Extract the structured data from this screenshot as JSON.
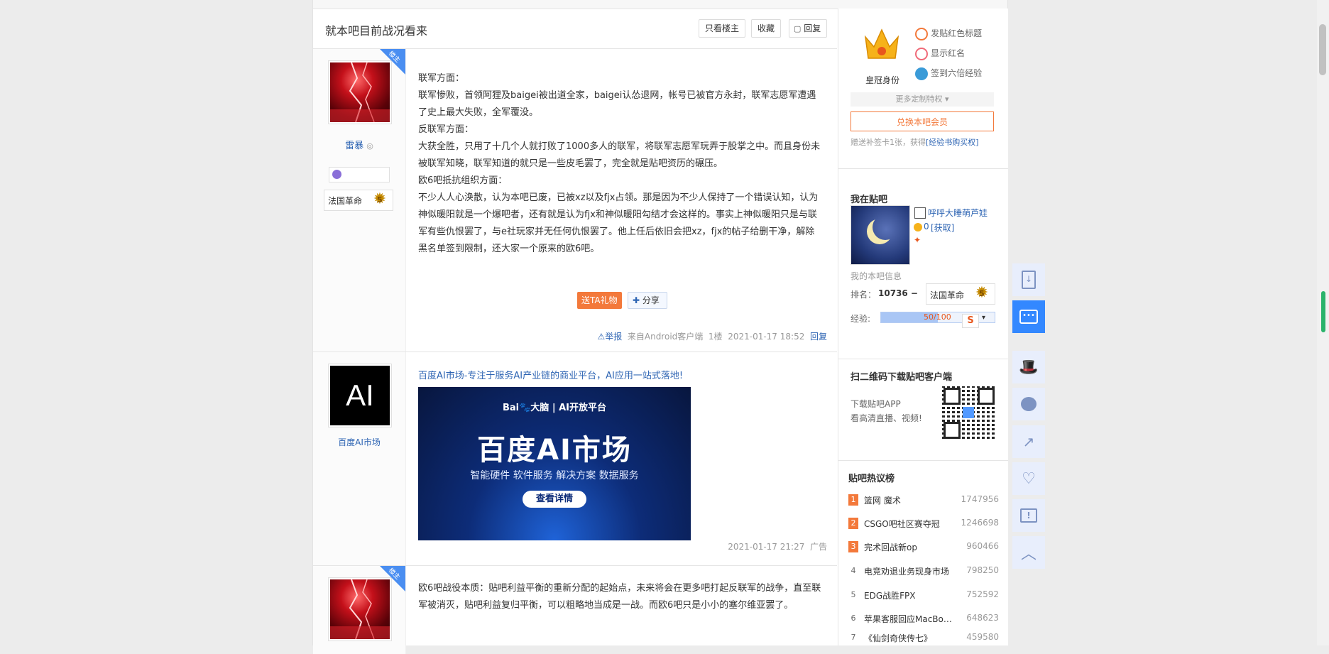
{
  "thread": {
    "title": "就本吧目前战况看来",
    "buttons": {
      "only_op": "只看楼主",
      "favorite": "收藏",
      "reply": "回复"
    }
  },
  "post1": {
    "badge": "楼主",
    "author": "雷暴",
    "tag": "法国革命",
    "level": "5",
    "paragraphs": [
      "联军方面：",
      "联军惨败，首领阿狸及baigei被出道全家，baigei认怂退网，帐号已被官方永封，联军志愿军遭遇了史上最大失败，全军覆没。",
      "反联军方面：",
      "大获全胜，只用了十几个人就打败了1000多人的联军，将联军志愿军玩弄于股掌之中。而且身份未被联军知晓，联军知道的就只是一些皮毛罢了，完全就是贴吧资历的碾压。",
      "欧6吧抵抗组织方面：",
      "不少人人心涣散，认为本吧已废，已被xz以及fjx占领。那是因为不少人保持了一个错误认知，认为神似暖阳就是一个爆吧者，还有就是认为fjx和神似暖阳勾结才会这样的。事实上神似暖阳只是与联军有些仇恨罢了，与e社玩家并无任何仇恨罢了。他上任后依旧会把xz，fjx的帖子给删干净，解除黑名单签到限制，还大家一个原来的欧6吧。"
    ],
    "gift": "送TA礼物",
    "share": "分享",
    "report": "举报",
    "source": "来自Android客户端",
    "floor": "1楼",
    "time": "2021-01-17 18:52",
    "reply": "回复"
  },
  "ad": {
    "author": "百度AI市场",
    "avatar_text": "AI",
    "link": "百度AI市场-专注于服务AI产业链的商业平台，AI应用一站式落地!",
    "banner_top": "Bai🐾大脑 | AI开放平台",
    "banner_title": "百度AI市场",
    "banner_sub": "智能硬件  软件服务  解决方案  数据服务",
    "banner_btn": "查看详情",
    "time": "2021-01-17 21:27",
    "label": "广告"
  },
  "post3": {
    "badge": "楼主",
    "text": "欧6吧战役本质：贴吧利益平衡的重新分配的起始点，未来将会在更多吧打起反联军的战争，直至联军被消灭，贴吧利益复归平衡，可以粗略地当成是一战。而欧6吧只是小小的塞尔维亚罢了。"
  },
  "sidebar": {
    "crown_label": "皇冠身份",
    "perks": [
      "发贴红色标题",
      "显示红名",
      "签到六倍经验"
    ],
    "more_perks": "更多定制特权 ▾",
    "member_btn": "兑换本吧会员",
    "promo": "赠送补签卡1张，获得",
    "promo_link": "[经验书购买权]",
    "my_tieba": "我在贴吧",
    "username": "呼呼大睡萌芦娃",
    "coin": "0",
    "coin_link": "[获取]",
    "my_info": "我的本吧信息",
    "rank_label": "排名：",
    "rank_value": "10736 −",
    "rank_tag": "法国革命",
    "rank_level": "5",
    "exp_label": "经验:",
    "exp_value": "50/100",
    "qr_title": "扫二维码下载贴吧客户端",
    "qr_line1": "下载贴吧APP",
    "qr_line2": "看高清直播、视频!",
    "hot_title": "贴吧热议榜",
    "hot": [
      {
        "n": "1",
        "t": "篮网 魔术",
        "v": "1747956"
      },
      {
        "n": "2",
        "t": "CSGO吧社区赛夺冠",
        "v": "1246698"
      },
      {
        "n": "3",
        "t": "完术回战新op",
        "v": "960466"
      },
      {
        "n": "4",
        "t": "电竞劝退业务现身市场",
        "v": "798250"
      },
      {
        "n": "5",
        "t": "EDG战胜FPX",
        "v": "752592"
      },
      {
        "n": "6",
        "t": "苹果客服回应MacBo…",
        "v": "648623"
      },
      {
        "n": "7",
        "t": "《仙剑奇侠传七》",
        "v": "459580"
      }
    ]
  },
  "colors": {
    "accent": "#2d64b3",
    "hot_top": "#f3793b",
    "float_bg": "#e8eefc",
    "float_active": "#3388ff"
  }
}
